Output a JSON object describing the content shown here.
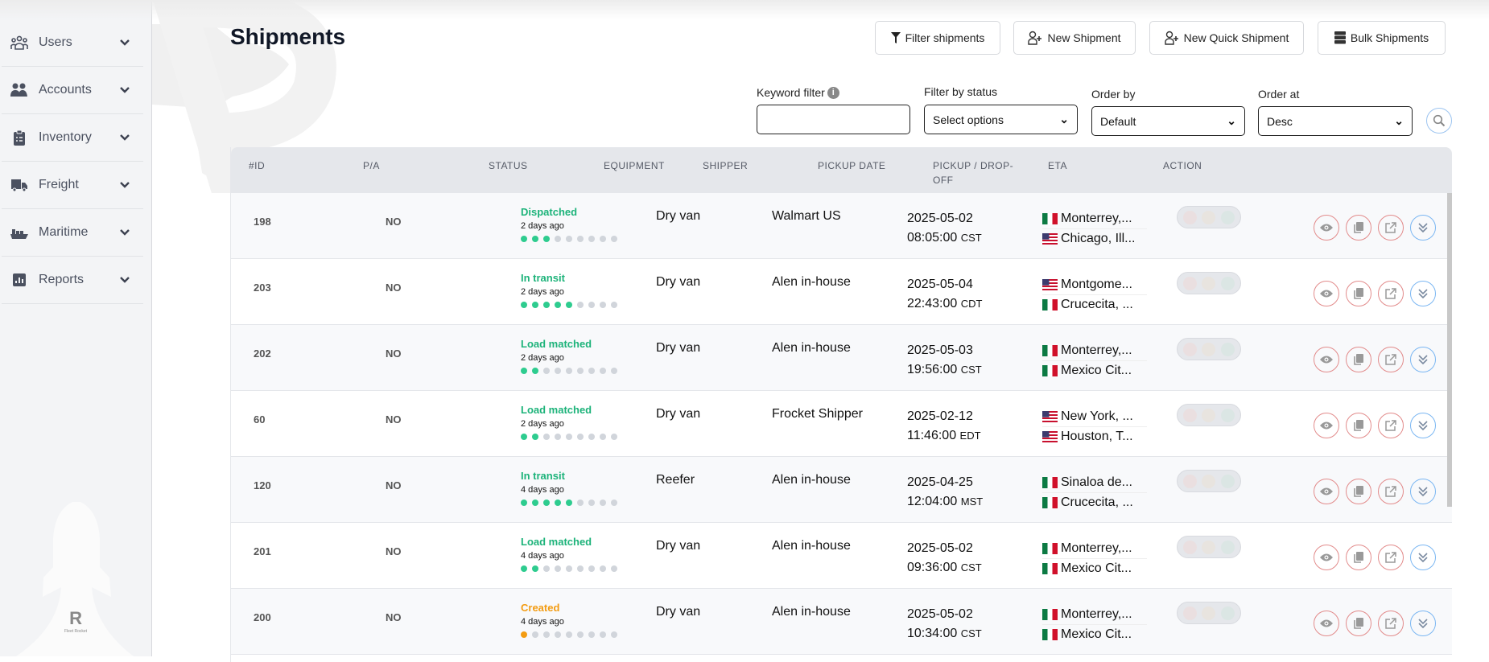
{
  "sidebar": {
    "items": [
      {
        "label": "Users",
        "icon": "users-group-icon"
      },
      {
        "label": "Accounts",
        "icon": "accounts-icon"
      },
      {
        "label": "Inventory",
        "icon": "clipboard-icon"
      },
      {
        "label": "Freight",
        "icon": "truck-icon"
      },
      {
        "label": "Maritime",
        "icon": "ship-icon"
      },
      {
        "label": "Reports",
        "icon": "chart-icon"
      }
    ],
    "logo_text": "R",
    "logo_sub": "Fleet Rocket"
  },
  "page": {
    "title": "Shipments"
  },
  "toolbar": {
    "filter_label": "Filter shipments",
    "new_label": "New Shipment",
    "quick_label": "New Quick Shipment",
    "bulk_label": "Bulk Shipments"
  },
  "filters": {
    "keyword_label": "Keyword filter",
    "keyword_value": "",
    "status_label": "Filter by status",
    "status_value": "Select options",
    "order_by_label": "Order by",
    "order_by_value": "Default",
    "order_at_label": "Order at",
    "order_at_value": "Desc"
  },
  "colors": {
    "green": "#2ecc8f",
    "orange": "#f39c12",
    "status_green_text": "#1db37a"
  },
  "table": {
    "headers": [
      "#ID",
      "P/A",
      "STATUS",
      "EQUIPMENT",
      "SHIPPER",
      "PICKUP DATE",
      "PICKUP / DROP-OFF",
      "ETA",
      "ACTION"
    ],
    "rows": [
      {
        "id": "198",
        "pa": "NO",
        "status": "Dispatched",
        "ago": "2 days ago",
        "progress": 3,
        "color": "green",
        "equipment": "Dry van",
        "shipper": "Walmart US",
        "date": "2025-05-02",
        "time": "08:05:00",
        "tz": "CST",
        "pickup": {
          "flag": "mx",
          "text": "Monterrey,..."
        },
        "dropoff": {
          "flag": "us",
          "text": "Chicago, Ill..."
        }
      },
      {
        "id": "203",
        "pa": "NO",
        "status": "In transit",
        "ago": "2 days ago",
        "progress": 5,
        "color": "green",
        "equipment": "Dry van",
        "shipper": "Alen in-house",
        "date": "2025-05-04",
        "time": "22:43:00",
        "tz": "CDT",
        "pickup": {
          "flag": "us",
          "text": "Montgome..."
        },
        "dropoff": {
          "flag": "mx",
          "text": "Crucecita, ..."
        }
      },
      {
        "id": "202",
        "pa": "NO",
        "status": "Load matched",
        "ago": "2 days ago",
        "progress": 2,
        "color": "green",
        "equipment": "Dry van",
        "shipper": "Alen in-house",
        "date": "2025-05-03",
        "time": "19:56:00",
        "tz": "CST",
        "pickup": {
          "flag": "mx",
          "text": "Monterrey,..."
        },
        "dropoff": {
          "flag": "mx",
          "text": "Mexico Cit..."
        }
      },
      {
        "id": "60",
        "pa": "NO",
        "status": "Load matched",
        "ago": "2 days ago",
        "progress": 2,
        "color": "green",
        "equipment": "Dry van",
        "shipper": "Frocket Shipper",
        "date": "2025-02-12",
        "time": "11:46:00",
        "tz": "EDT",
        "pickup": {
          "flag": "us",
          "text": "New York, ..."
        },
        "dropoff": {
          "flag": "us",
          "text": "Houston, T..."
        }
      },
      {
        "id": "120",
        "pa": "NO",
        "status": "In transit",
        "ago": "4 days ago",
        "progress": 5,
        "color": "green",
        "equipment": "Reefer",
        "shipper": "Alen in-house",
        "date": "2025-04-25",
        "time": "12:04:00",
        "tz": "MST",
        "pickup": {
          "flag": "mx",
          "text": "Sinaloa de..."
        },
        "dropoff": {
          "flag": "mx",
          "text": "Crucecita, ..."
        }
      },
      {
        "id": "201",
        "pa": "NO",
        "status": "Load matched",
        "ago": "4 days ago",
        "progress": 2,
        "color": "green",
        "equipment": "Dry van",
        "shipper": "Alen in-house",
        "date": "2025-05-02",
        "time": "09:36:00",
        "tz": "CST",
        "pickup": {
          "flag": "mx",
          "text": "Monterrey,..."
        },
        "dropoff": {
          "flag": "mx",
          "text": "Mexico Cit..."
        }
      },
      {
        "id": "200",
        "pa": "NO",
        "status": "Created",
        "ago": "4 days ago",
        "progress": 1,
        "color": "orange",
        "equipment": "Dry van",
        "shipper": "Alen in-house",
        "date": "2025-05-02",
        "time": "10:34:00",
        "tz": "CST",
        "pickup": {
          "flag": "mx",
          "text": "Monterrey,..."
        },
        "dropoff": {
          "flag": "mx",
          "text": "Mexico Cit..."
        }
      }
    ]
  }
}
